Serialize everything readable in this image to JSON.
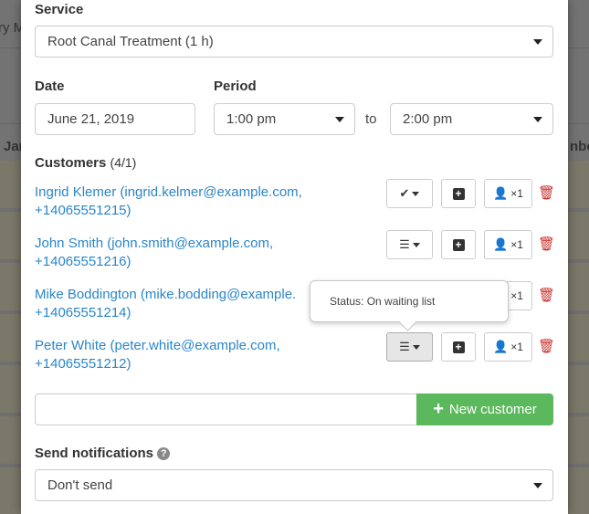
{
  "background": {
    "left_top": "ry M",
    "left_mid": "Jar",
    "right_mid": "nbe"
  },
  "service": {
    "label": "Service",
    "value": "Root Canal Treatment (1 h)"
  },
  "date": {
    "label": "Date",
    "value": "June 21, 2019"
  },
  "period": {
    "label": "Period",
    "from": "1:00 pm",
    "to_label": "to",
    "to": "2:00 pm"
  },
  "customers": {
    "label": "Customers",
    "count": "(4/1)",
    "items": [
      {
        "line1": "Ingrid Klemer (ingrid.kelmer@example.com,",
        "line2": "+14065551215)",
        "status_icon": "check-icon",
        "persons": "×1"
      },
      {
        "line1": "John Smith (john.smith@example.com,",
        "line2": "+14065551216)",
        "status_icon": "list-icon",
        "persons": "×1"
      },
      {
        "line1": "Mike Boddington (mike.bodding@example.",
        "line2": "+14065551214)",
        "status_icon": "list-icon",
        "persons": "×1"
      },
      {
        "line1": "Peter White (peter.white@example.com,",
        "line2": "+14065551212)",
        "status_icon": "list-icon",
        "persons": "×1"
      }
    ]
  },
  "tooltip": "Status: On waiting list",
  "new_customer": {
    "input_value": "",
    "button": "New customer",
    "color": "#5cb85c"
  },
  "notifications": {
    "label": "Send notifications",
    "value": "Don't send"
  },
  "colors": {
    "link": "#2a86c8",
    "danger": "#c9302c"
  }
}
